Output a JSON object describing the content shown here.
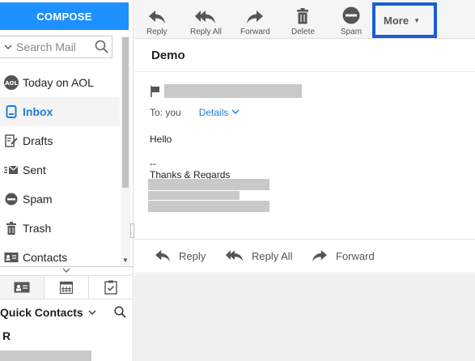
{
  "left": {
    "compose_label": "COMPOSE",
    "search_placeholder": "Search Mail",
    "folders": [
      {
        "label": "Today on AOL",
        "icon": "aol-icon"
      },
      {
        "label": "Inbox",
        "icon": "inbox-icon"
      },
      {
        "label": "Drafts",
        "icon": "drafts-icon"
      },
      {
        "label": "Sent",
        "icon": "sent-icon"
      },
      {
        "label": "Spam",
        "icon": "spam-icon"
      },
      {
        "label": "Trash",
        "icon": "trash-icon"
      },
      {
        "label": "Contacts",
        "icon": "contacts-icon"
      }
    ],
    "active_folder": "Inbox",
    "contact_tabs": [
      "contact-card-icon",
      "calendar-icon",
      "tasks-icon"
    ],
    "quick_contacts_label": "Quick Contacts",
    "quick_contacts_letter": "R",
    "aol_badge": "AOL"
  },
  "toolbar": {
    "buttons": [
      {
        "label": "Reply",
        "icon": "reply-icon"
      },
      {
        "label": "Reply All",
        "icon": "reply-all-icon"
      },
      {
        "label": "Forward",
        "icon": "forward-icon"
      },
      {
        "label": "Delete",
        "icon": "trash-icon"
      },
      {
        "label": "Spam",
        "icon": "spam-icon"
      }
    ],
    "more_label": "More"
  },
  "message": {
    "subject": "Demo",
    "to_label": "To: you",
    "details_label": "Details",
    "body_hello": "Hello",
    "body_sig_dash": "--",
    "body_regards": "Thanks & Regards"
  },
  "bottom_actions": {
    "reply": "Reply",
    "reply_all": "Reply All",
    "forward": "Forward"
  },
  "colors": {
    "accent": "#1e90ff",
    "link": "#1e7fd8",
    "highlight_border": "#1a5dd6"
  }
}
